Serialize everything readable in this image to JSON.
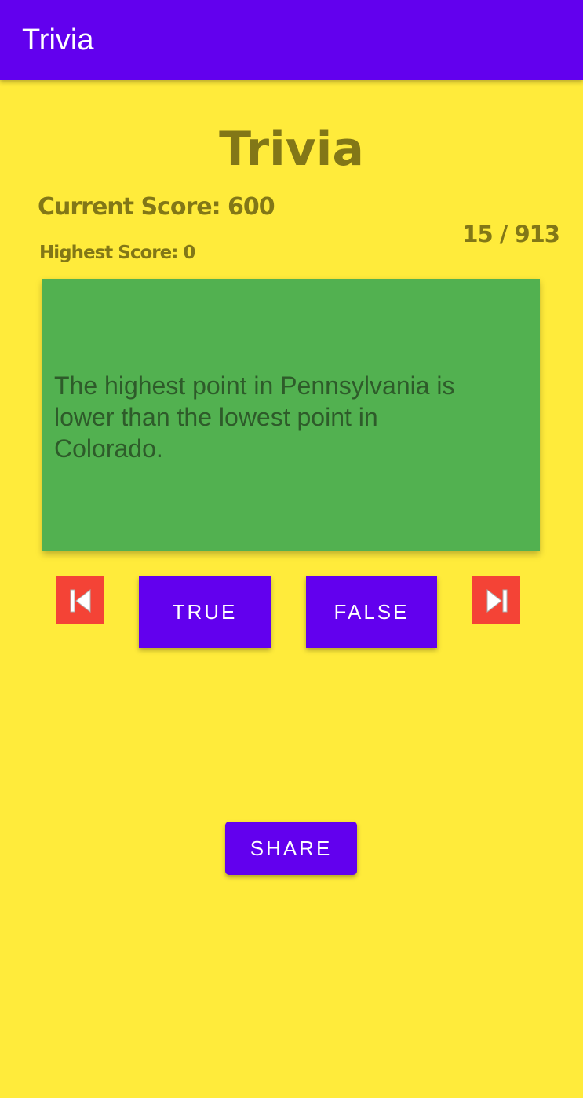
{
  "app_bar": {
    "title": "Trivia"
  },
  "header": {
    "title": "Trivia",
    "current_score": "Current Score: 600",
    "highest_score": "Highest Score: 0",
    "question_counter": "15 / 913"
  },
  "question": {
    "text": "The highest point in Pennsylvania is lower than the lowest point in Colorado."
  },
  "controls": {
    "prev_icon": "skip-previous-icon",
    "next_icon": "skip-next-icon",
    "true_label": "TRUE",
    "false_label": "FALSE",
    "share_label": "SHARE"
  },
  "colors": {
    "app_bar": "#6200EE",
    "background": "#FFEB3B",
    "card": "#52B150",
    "nav_button": "#F44336",
    "heading_text": "#827717"
  }
}
